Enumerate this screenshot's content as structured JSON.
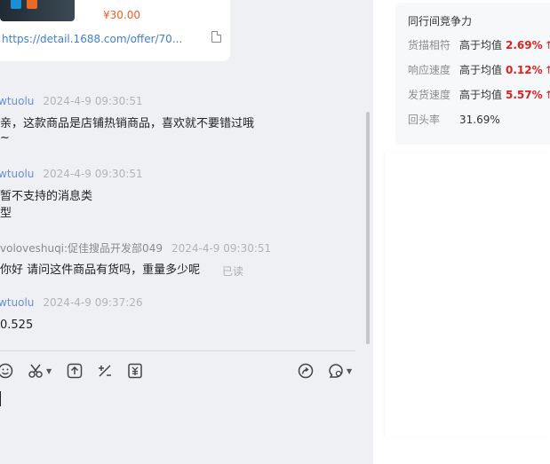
{
  "chat": {
    "card": {
      "price": "¥30.00",
      "link": "https://detail.1688.com/offer/70..."
    },
    "messages": [
      {
        "sender": "wtuolu",
        "time": "2024-4-9 09:30:51",
        "lines": [
          "亲，这款商品是店铺热销商品，喜欢就不要错过哦",
          "~"
        ]
      },
      {
        "sender": "wtuolu",
        "time": "2024-4-9 09:30:51",
        "lines": [
          "暂不支持的消息类",
          "型"
        ]
      },
      {
        "sender": "voloveshuqi:促佳搜品开发部049",
        "time": "2024-4-9 09:30:51",
        "lines": [
          "你好 请问这件商品有货吗，重量多少呢"
        ],
        "status": "已读"
      },
      {
        "sender": "wtuolu",
        "time": "2024-4-9 09:37:26",
        "lines": [
          "0.525"
        ]
      }
    ]
  },
  "toolbar": {
    "icons": [
      "emoji-icon",
      "scissors-icon",
      "upload-icon",
      "calculator-icon",
      "coupon-icon",
      "share-icon",
      "settings-icon"
    ]
  },
  "competitiveness": {
    "title": "同行间竞争力",
    "rows": [
      {
        "label": "货描相符",
        "compare": "高于均值",
        "percent": "2.69%",
        "arrow": "↑"
      },
      {
        "label": "响应速度",
        "compare": "高于均值",
        "percent": "0.12%",
        "arrow": "↑"
      },
      {
        "label": "发货速度",
        "compare": "高于均值",
        "percent": "5.57%",
        "arrow": "↑"
      },
      {
        "label": "回头率",
        "value": "31.69%"
      }
    ]
  },
  "colors": {
    "accent_red": "#e02020",
    "link_blue": "#3f7fd8",
    "price_orange": "#f25c1f"
  }
}
